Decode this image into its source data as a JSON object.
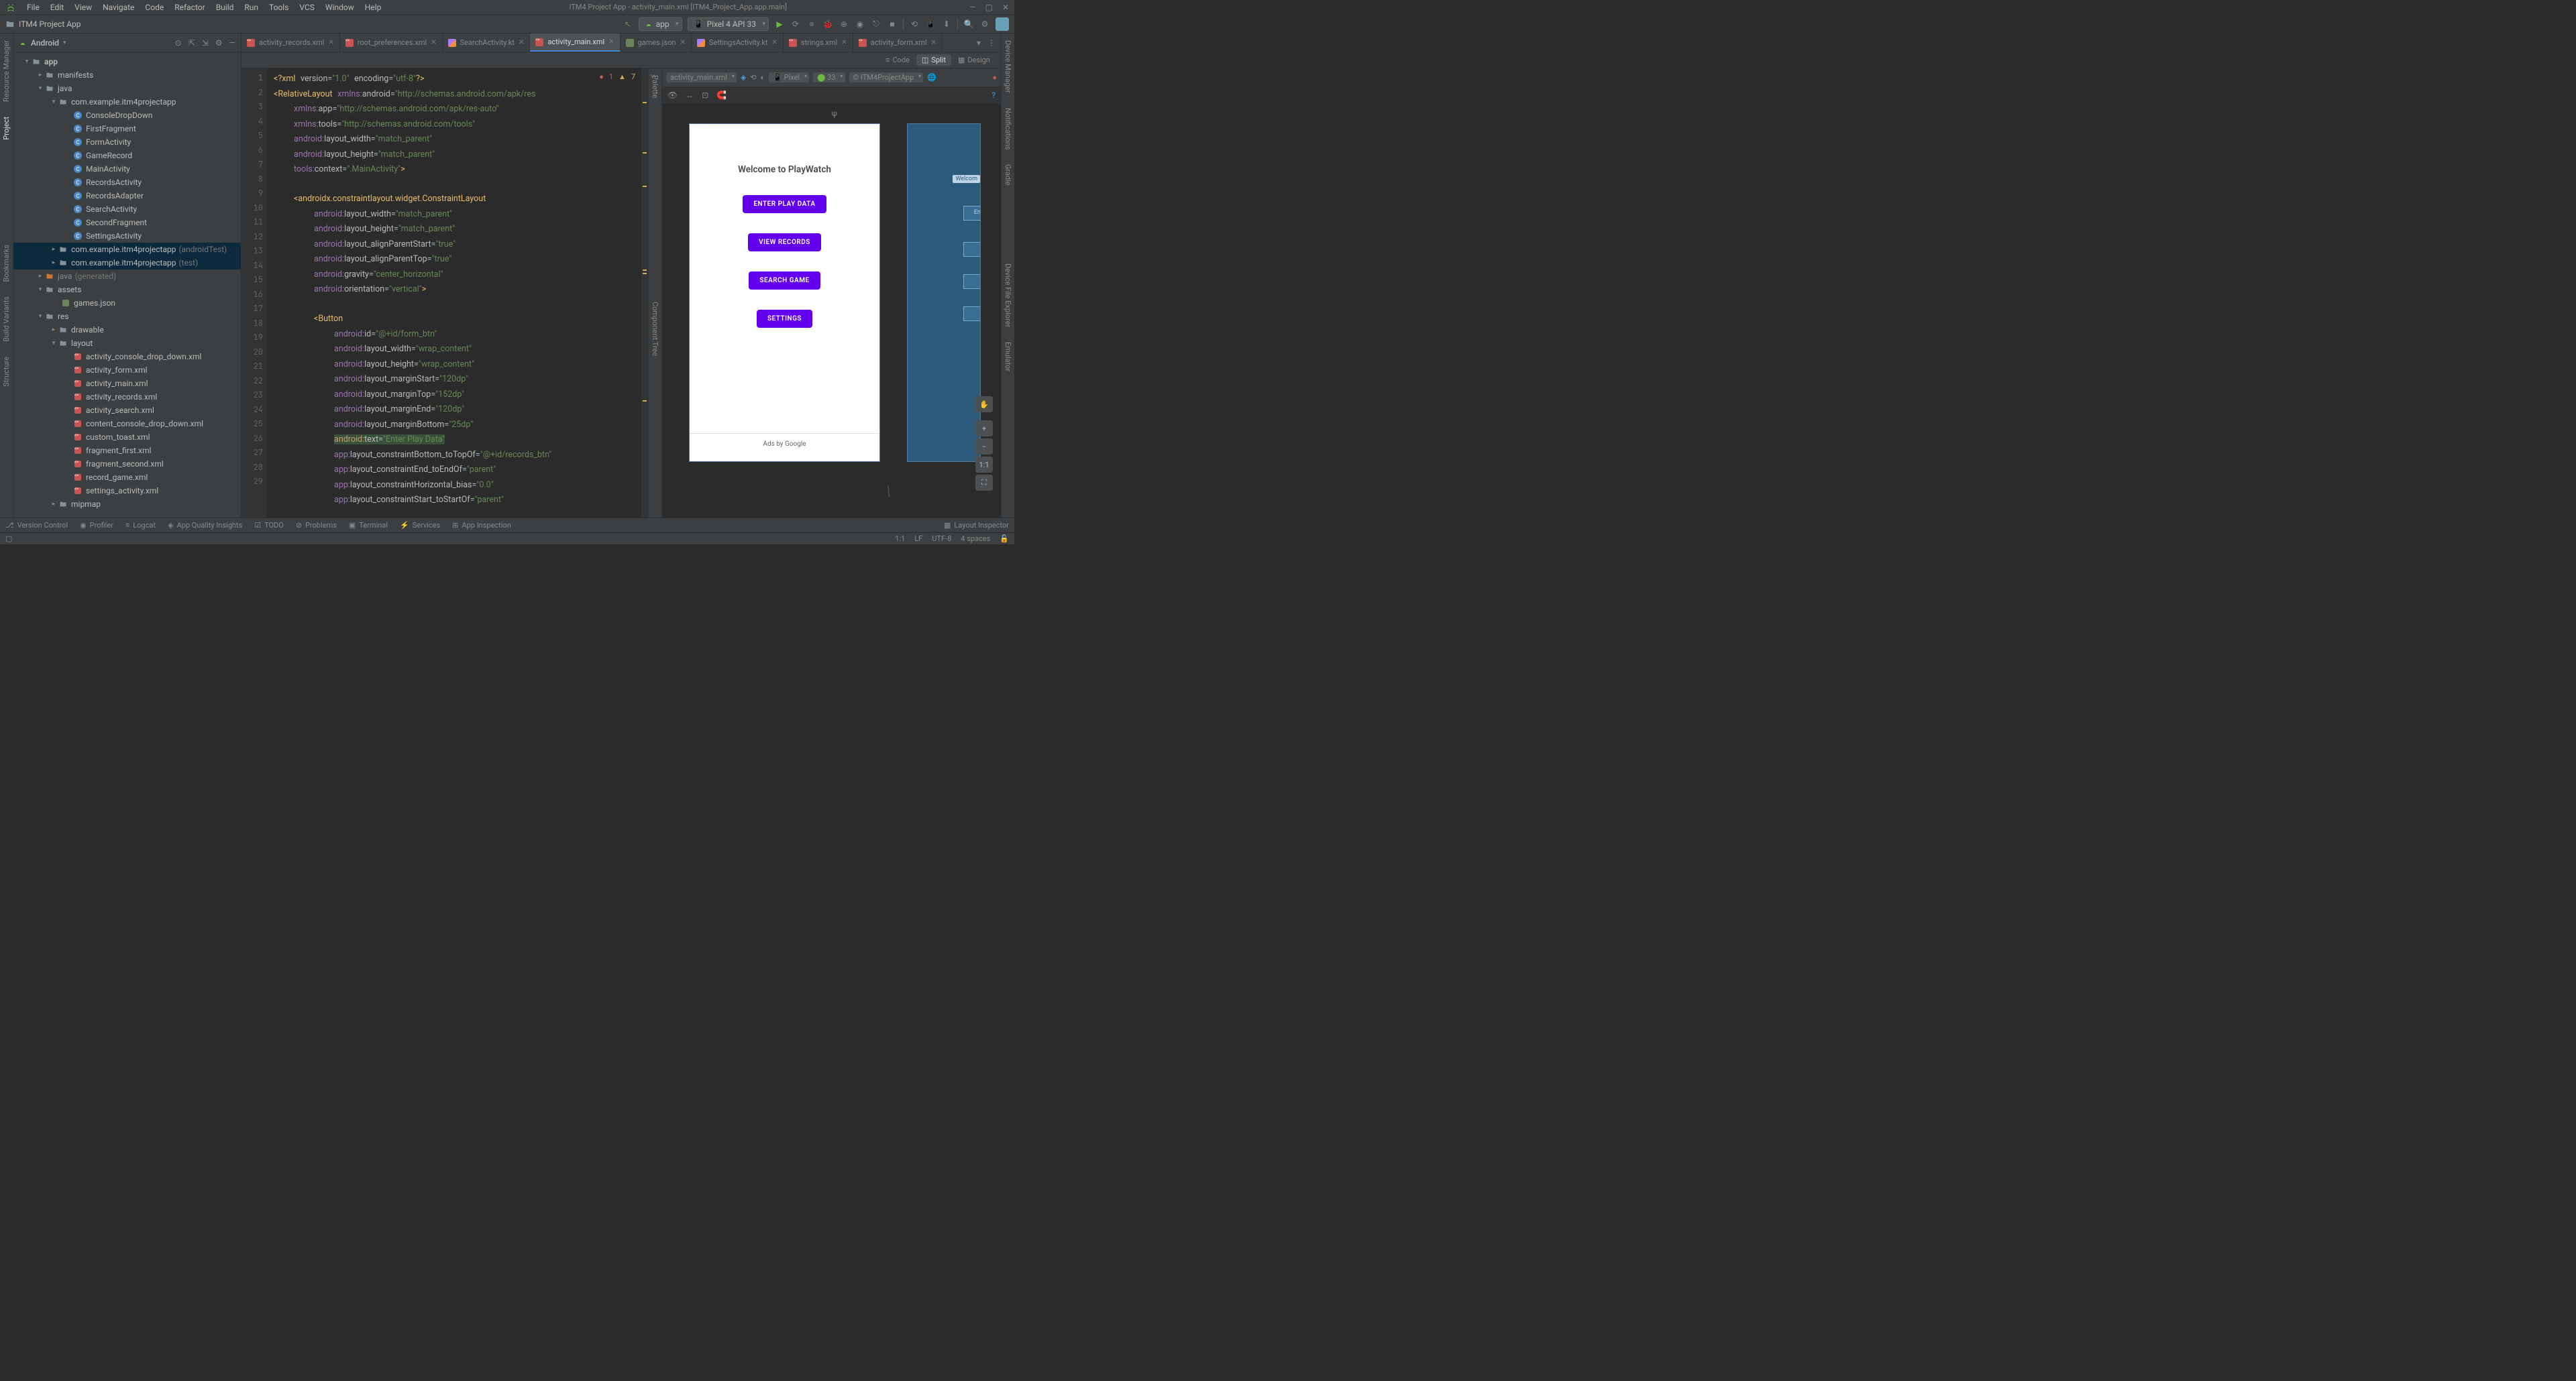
{
  "menubar": {
    "items": [
      "File",
      "Edit",
      "View",
      "Navigate",
      "Code",
      "Refactor",
      "Build",
      "Run",
      "Tools",
      "VCS",
      "Window",
      "Help"
    ],
    "title": "ITM4 Project App - activity_main.xml [ITM4_Project_App.app.main]"
  },
  "navbar": {
    "project": "ITM4 Project App",
    "run_config": "app",
    "device": "Pixel 4 API 33"
  },
  "project_panel": {
    "title": "Android",
    "tree": {
      "root": "app",
      "manifests": "manifests",
      "java": "java",
      "pkg1": "com.example.itm4projectapp",
      "classes": [
        "ConsoleDropDown",
        "FirstFragment",
        "FormActivity",
        "GameRecord",
        "MainActivity",
        "RecordsActivity",
        "RecordsAdapter",
        "SearchActivity",
        "SecondFragment",
        "SettingsActivity"
      ],
      "pkg2": "com.example.itm4projectapp",
      "pkg2_suffix": "(androidTest)",
      "pkg3": "com.example.itm4projectapp",
      "pkg3_suffix": "(test)",
      "java_gen": "java",
      "java_gen_suffix": "(generated)",
      "assets": "assets",
      "games_json": "games.json",
      "res": "res",
      "drawable": "drawable",
      "layout": "layout",
      "layouts": [
        "activity_console_drop_down.xml",
        "activity_form.xml",
        "activity_main.xml",
        "activity_records.xml",
        "activity_search.xml",
        "content_console_drop_down.xml",
        "custom_toast.xml",
        "fragment_first.xml",
        "fragment_second.xml",
        "record_game.xml",
        "settings_activity.xml"
      ],
      "mipmap": "mipmap"
    }
  },
  "editor": {
    "tabs": [
      {
        "label": "activity_records.xml",
        "icon": "xml"
      },
      {
        "label": "root_preferences.xml",
        "icon": "xml"
      },
      {
        "label": "SearchActivity.kt",
        "icon": "kt"
      },
      {
        "label": "activity_main.xml",
        "icon": "xml",
        "active": true
      },
      {
        "label": "games.json",
        "icon": "json"
      },
      {
        "label": "SettingsActivity.kt",
        "icon": "kt"
      },
      {
        "label": "strings.xml",
        "icon": "xml"
      },
      {
        "label": "activity_form.xml",
        "icon": "xml"
      }
    ],
    "viewmodes": {
      "code": "Code",
      "split": "Split",
      "design": "Design"
    },
    "inspections": {
      "errors": "1",
      "warnings": "7"
    },
    "code_lines": 29
  },
  "design": {
    "file": "activity_main.xml",
    "device": "Pixel",
    "api": "33",
    "theme": "ITM4ProjectApp",
    "phone": {
      "title": "Welcome to PlayWatch",
      "btn1": "ENTER PLAY DATA",
      "btn2": "VIEW RECORDS",
      "btn3": "SEARCH GAME",
      "btn4": "SETTINGS",
      "footer": "Ads by Google"
    },
    "blueprint_label": "Welcom",
    "blueprint_en": "En",
    "zoom_11": "1:1"
  },
  "left_rail": [
    "Resource Manager",
    "Project",
    "Bookmarks",
    "Build Variants",
    "Structure"
  ],
  "right_rail": [
    "Gradle",
    "Notifications",
    "Device Manager",
    "Device File Explorer",
    "Emulator"
  ],
  "palette_label": "Palette",
  "component_tree_label": "Component Tree",
  "bottombar": {
    "items": [
      "Version Control",
      "Profiler",
      "Logcat",
      "App Quality Insights",
      "TODO",
      "Problems",
      "Terminal",
      "Services",
      "App Inspection"
    ],
    "right": "Layout Inspector"
  },
  "statusbar": {
    "pos": "1:1",
    "le": "LF",
    "enc": "UTF-8",
    "indent": "4 spaces"
  }
}
